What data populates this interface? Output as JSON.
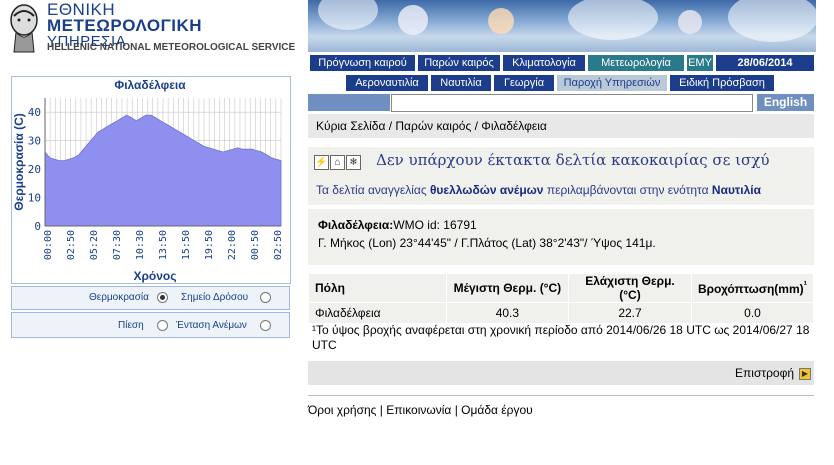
{
  "logo": {
    "line1": "ΕΘΝΙΚΗ",
    "line2": "ΜΕΤΕΩΡΟΛΟΓΙΚΗ",
    "line3": "ΥΠΗΡΕΣΙΑ",
    "line4": "HELLENIC NATIONAL METEOROLOGICAL SERVICE"
  },
  "nav": {
    "row1": [
      "Πρόγνωση καιρού",
      "Παρών καιρός",
      "Κλιματολογία",
      "Μετεωρολογία",
      "ΕΜΥ"
    ],
    "date": "28/06/2014",
    "row2": [
      "Αεροναυτιλία",
      "Ναυτιλία",
      "Γεωργία",
      "Παροχή Υπηρεσιών",
      "Ειδική Πρόσβαση"
    ]
  },
  "search": {
    "value": "",
    "english": "English"
  },
  "breadcrumb": "Κύρια Σελίδα / Παρών καιρός / Φιλαδέλφεια",
  "warning": {
    "icons": [
      "lightning-icon",
      "home-icon",
      "snow-icon"
    ],
    "title": "Δεν υπάρχουν έκτακτα δελτία κακοκαιρίας σε ισχύ",
    "sub_pre": "Τα δελτία αναγγελίας ",
    "sub_b1": "θυελλωδών ανέμων",
    "sub_mid": " περιλαμβάνονται στην ενότητα ",
    "sub_b2": "Ναυτιλία"
  },
  "station": {
    "name": "Φιλαδέλφεια:",
    "wmo": "WMO id: 16791",
    "coords": "Γ. Μήκος (Lon) 23°44'45\" / Γ.Πλάτος (Lat) 38°2'43\"/ Ύψος 141μ."
  },
  "table": {
    "headers": [
      "Πόλη",
      "Μέγιστη Θερμ. (°C)",
      "Ελάχιστη Θερμ.(°C)",
      "Βροχόπτωση(mm)"
    ],
    "header_footnote_mark": "¹",
    "row": [
      "Φιλαδέλφεια",
      "40.3",
      "22.7",
      "0.0"
    ]
  },
  "footnote": "¹Το ύψος βροχής αναφέρεται στη χρονική περίοδο από 2014/06/26 18 UTC ως 2014/06/27 18 UTC",
  "back": "Επιστροφή",
  "footer": "Όροι χρήσης | Επικοινωνία | Ομάδα έργου",
  "chart_data": {
    "type": "area",
    "title": "Φιλαδέλφεια",
    "xlabel": "Χρόνος",
    "ylabel": "Θερμοκρασία (C)",
    "ylim": [
      0,
      45
    ],
    "yticks": [
      0,
      10,
      20,
      30,
      40
    ],
    "xticks": [
      "00:00",
      "02:50",
      "05:20",
      "07:30",
      "10:30",
      "13:50",
      "15:50",
      "19:50",
      "22:00",
      "00:50",
      "02:50"
    ],
    "series": [
      {
        "values": [
          26,
          24,
          23.5,
          23,
          23,
          23.5,
          24,
          25,
          27,
          29,
          31,
          33,
          34,
          35,
          36,
          37,
          38,
          39,
          38,
          37,
          38,
          39,
          39,
          38,
          37,
          36,
          35,
          34,
          33,
          32,
          31,
          30,
          29,
          28,
          27.5,
          27,
          26.5,
          26,
          26.5,
          27,
          27.5,
          27,
          27,
          27,
          26.5,
          26,
          25,
          24,
          23.5,
          23
        ]
      }
    ],
    "fill_color": "#8f8ff0",
    "grid": true
  },
  "controls": {
    "temperature": "Θερμοκρασία",
    "dewpoint": "Σημείο Δρόσου",
    "pressure": "Πίεση",
    "wind": "Ένταση Ανέμων",
    "selected": "temperature"
  }
}
